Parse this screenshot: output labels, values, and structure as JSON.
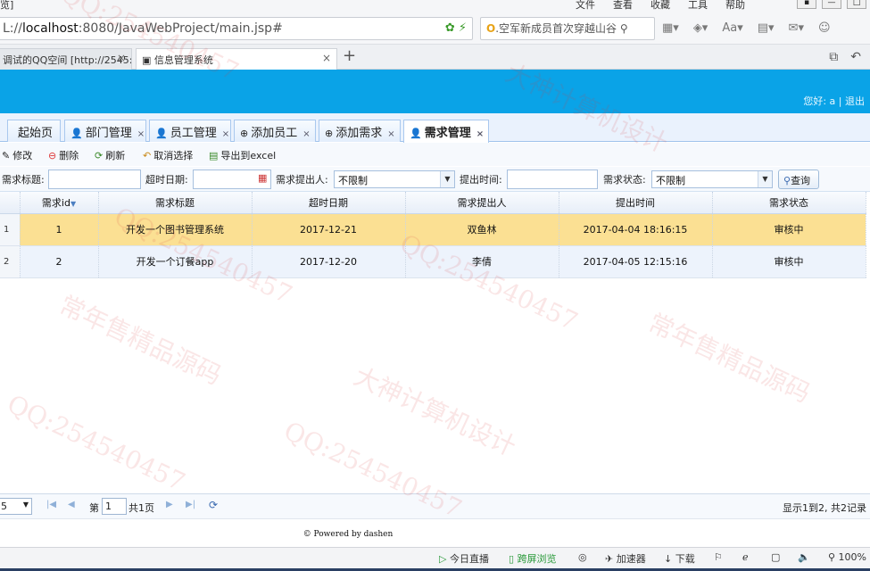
{
  "browser": {
    "menubar_left": "览]",
    "menus": [
      "文件",
      "查看",
      "收藏",
      "工具",
      "帮助"
    ],
    "url_prefix": "L://",
    "url_host": "localhost",
    "url_rest": ":8080/JavaWebProject/main.jsp#",
    "search_text": "空军新成员首次穿越山谷",
    "tabs": [
      {
        "label": "调试的QQ空间 [http://2545:",
        "active": false
      },
      {
        "label": "信息管理系统",
        "active": true
      }
    ],
    "new_tab": "+"
  },
  "app": {
    "greeting": "您好: a | 退出",
    "tabs": [
      {
        "label": "起始页",
        "icon": "",
        "closable": false
      },
      {
        "label": "部门管理",
        "icon": "person-icon",
        "closable": true
      },
      {
        "label": "员工管理",
        "icon": "person-icon",
        "closable": true
      },
      {
        "label": "添加员工",
        "icon": "add-icon",
        "closable": true
      },
      {
        "label": "添加需求",
        "icon": "add-icon",
        "closable": true
      },
      {
        "label": "需求管理",
        "icon": "person-icon",
        "closable": true,
        "active": true
      }
    ],
    "toolbar": {
      "edit": "修改",
      "delete": "删除",
      "refresh": "刷新",
      "unselect": "取消选择",
      "export": "导出到excel"
    },
    "filters": {
      "title_label": "需求标题:",
      "timeout_label": "超时日期:",
      "proposer_label": "需求提出人:",
      "proposer_value": "不限制",
      "time_label": "提出时间:",
      "status_label": "需求状态:",
      "status_value": "不限制",
      "query": "查询"
    },
    "grid": {
      "columns": [
        "需求id",
        "需求标题",
        "超时日期",
        "需求提出人",
        "提出时间",
        "需求状态"
      ],
      "rows": [
        {
          "rn": "1",
          "id": "1",
          "title": "开发一个图书管理系统",
          "deadline": "2017-12-21",
          "proposer": "双鱼林",
          "time": "2017-04-04 18:16:15",
          "status": "审核中"
        },
        {
          "rn": "2",
          "id": "2",
          "title": "开发一个订餐app",
          "deadline": "2017-12-20",
          "proposer": "李倩",
          "time": "2017-04-05 12:15:16",
          "status": "审核中"
        }
      ]
    },
    "pager": {
      "page_size": "5",
      "page_prefix": "第",
      "page_num": "1",
      "page_suffix": "共1页",
      "summary": "显示1到2, 共2记录"
    },
    "footer": "© Powered by dashen"
  },
  "statusbar": {
    "live": "今日直播",
    "cross_screen": "跨屏浏览",
    "accelerator": "加速器",
    "download": "下载",
    "zoom": "100%"
  },
  "watermarks": [
    "QQ:254540457",
    "大神计算机设计",
    "常年售精品源码"
  ]
}
